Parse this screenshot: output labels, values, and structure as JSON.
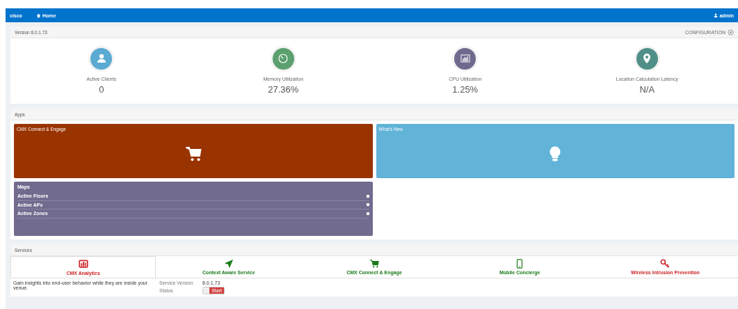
{
  "navbar": {
    "logo": "cisco",
    "home": "Home",
    "user": "admin"
  },
  "system": {
    "version": "Version 8.0.1.73",
    "configuration": "CONFIGURATION",
    "stats": [
      {
        "kind": "clients",
        "label": "Active Clients",
        "value": "0",
        "color": "#5aaad2"
      },
      {
        "kind": "memory",
        "label": "Memory Utilization",
        "value": "27.36%",
        "color": "#5ba06e"
      },
      {
        "kind": "cpu",
        "label": "CPU Utilization",
        "value": "1.25%",
        "color": "#6f6a8e"
      },
      {
        "kind": "location",
        "label": "Location Calculation Latency",
        "value": "N/A",
        "color": "#4f8f88"
      }
    ]
  },
  "apps": {
    "title": "Apps",
    "tiles": [
      {
        "kind": "cart",
        "title": "CMX Connect & Engage",
        "color": "#993300"
      },
      {
        "kind": "bulb",
        "title": "What's New",
        "color": "#62b3d8"
      }
    ],
    "maps": {
      "title": "Maps",
      "items": [
        "Active Floors",
        "Active APs",
        "Active Zones"
      ]
    }
  },
  "services": {
    "title": "Services",
    "tabs": [
      {
        "kind": "analytics",
        "label": "CMX Analytics",
        "selected": true,
        "color": "#cc2222"
      },
      {
        "kind": "arrow",
        "label": "Context Aware Service",
        "selected": false,
        "color": "#1a7a1a"
      },
      {
        "kind": "cart",
        "label": "CMX Connect & Engage",
        "selected": false,
        "color": "#1a7a1a"
      },
      {
        "kind": "phone",
        "label": "Mobile Concierge",
        "selected": false,
        "color": "#1a7a1a"
      },
      {
        "kind": "key",
        "label": "Wireless Intrusion Prevention",
        "selected": false,
        "color": "#cc2222"
      }
    ],
    "description": "Gain insights into end-user behavior while they are inside your venue.",
    "version_label": "Service Version",
    "version": "8.0.1.73",
    "status_label": "Status",
    "status_on": false,
    "status_button": "Start"
  }
}
